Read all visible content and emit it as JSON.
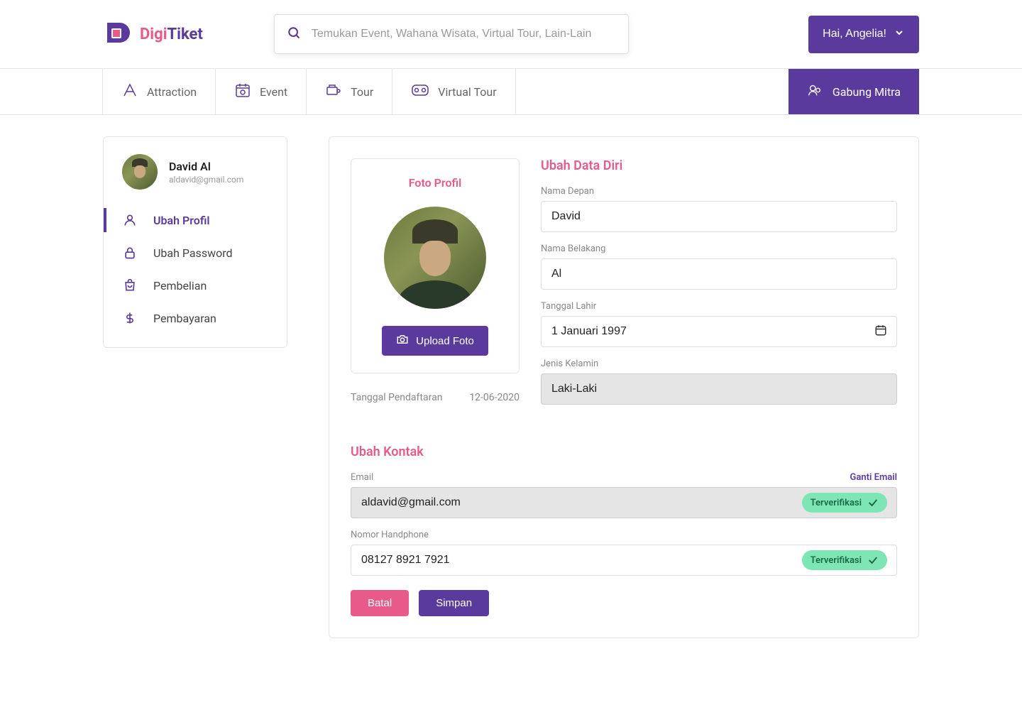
{
  "brand": {
    "part1": "Digi",
    "part2": "Tiket"
  },
  "search": {
    "placeholder": "Temukan Event, Wahana Wisata, Virtual Tour, Lain-Lain"
  },
  "user_greeting": "Hai, Angelia!",
  "nav": {
    "items": [
      {
        "label": "Attraction"
      },
      {
        "label": "Event"
      },
      {
        "label": "Tour"
      },
      {
        "label": "Virtual Tour"
      }
    ],
    "cta": "Gabung Mitra"
  },
  "sidebar": {
    "user_name": "David Al",
    "user_email": "aldavid@gmail.com",
    "menu": [
      {
        "label": "Ubah Profil"
      },
      {
        "label": "Ubah Password"
      },
      {
        "label": "Pembelian"
      },
      {
        "label": "Pembayaran"
      }
    ]
  },
  "photo": {
    "title": "Foto Profil",
    "upload_label": "Upload Foto"
  },
  "registration": {
    "label": "Tanggal Pendaftaran",
    "date": "12-06-2020"
  },
  "form": {
    "personal_title": "Ubah Data Diri",
    "first_name_label": "Nama Depan",
    "first_name": "David",
    "last_name_label": "Nama Belakang",
    "last_name": "Al",
    "dob_label": "Tanggal Lahir",
    "dob": "1 Januari 1997",
    "gender_label": "Jenis Kelamin",
    "gender": "Laki-Laki",
    "contact_title": "Ubah Kontak",
    "email_label": "Email",
    "change_email": "Ganti Email",
    "email": "aldavid@gmail.com",
    "phone_label": "Nomor Handphone",
    "phone": "08127 8921 7921",
    "verified": "Terverifikasi",
    "cancel": "Batal",
    "save": "Simpan"
  }
}
